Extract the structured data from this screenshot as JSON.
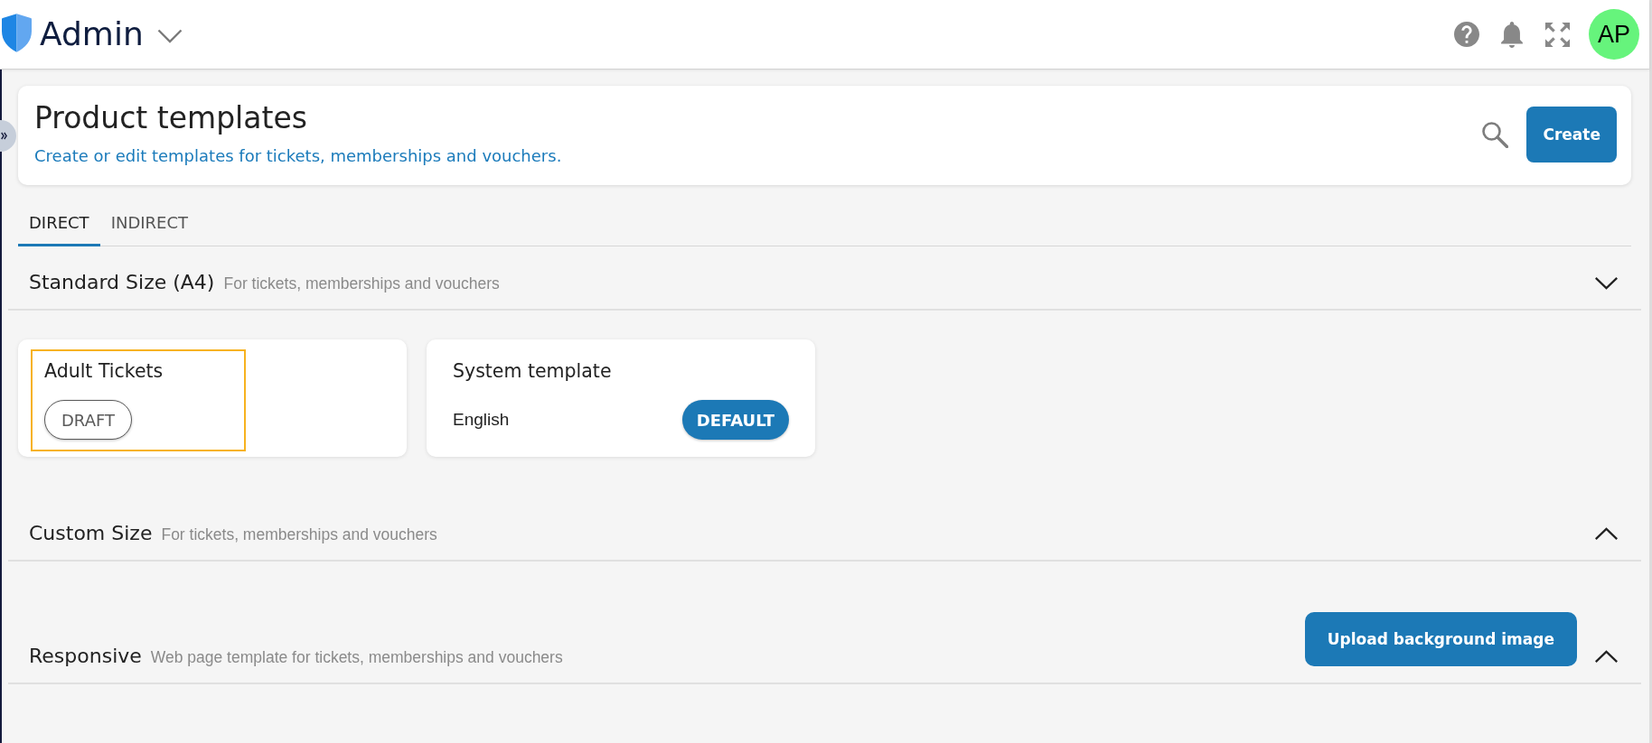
{
  "header": {
    "title": "Admin",
    "avatar": "AP"
  },
  "page": {
    "title": "Product templates",
    "subtitle": "Create or edit templates for tickets, memberships and vouchers.",
    "create_button": "Create"
  },
  "tabs": [
    {
      "label": "DIRECT",
      "selected": true
    },
    {
      "label": "INDIRECT",
      "selected": false
    }
  ],
  "sections": [
    {
      "title": "Standard Size (A4)",
      "subtitle": "For tickets, memberships and vouchers",
      "expanded": true,
      "templates": [
        {
          "name": "Adult Tickets",
          "focused": true,
          "badge": {
            "label": "DRAFT",
            "kind": "draft"
          }
        },
        {
          "name": "System template",
          "language": "English",
          "focused": false,
          "badge": {
            "label": "DEFAULT",
            "kind": "default"
          }
        }
      ]
    },
    {
      "title": "Custom Size",
      "subtitle": "For tickets, memberships and vouchers",
      "expanded": false
    },
    {
      "title": "Responsive",
      "subtitle": "Web page template for tickets, memberships and vouchers",
      "expanded": false,
      "action": "Upload background image"
    }
  ]
}
